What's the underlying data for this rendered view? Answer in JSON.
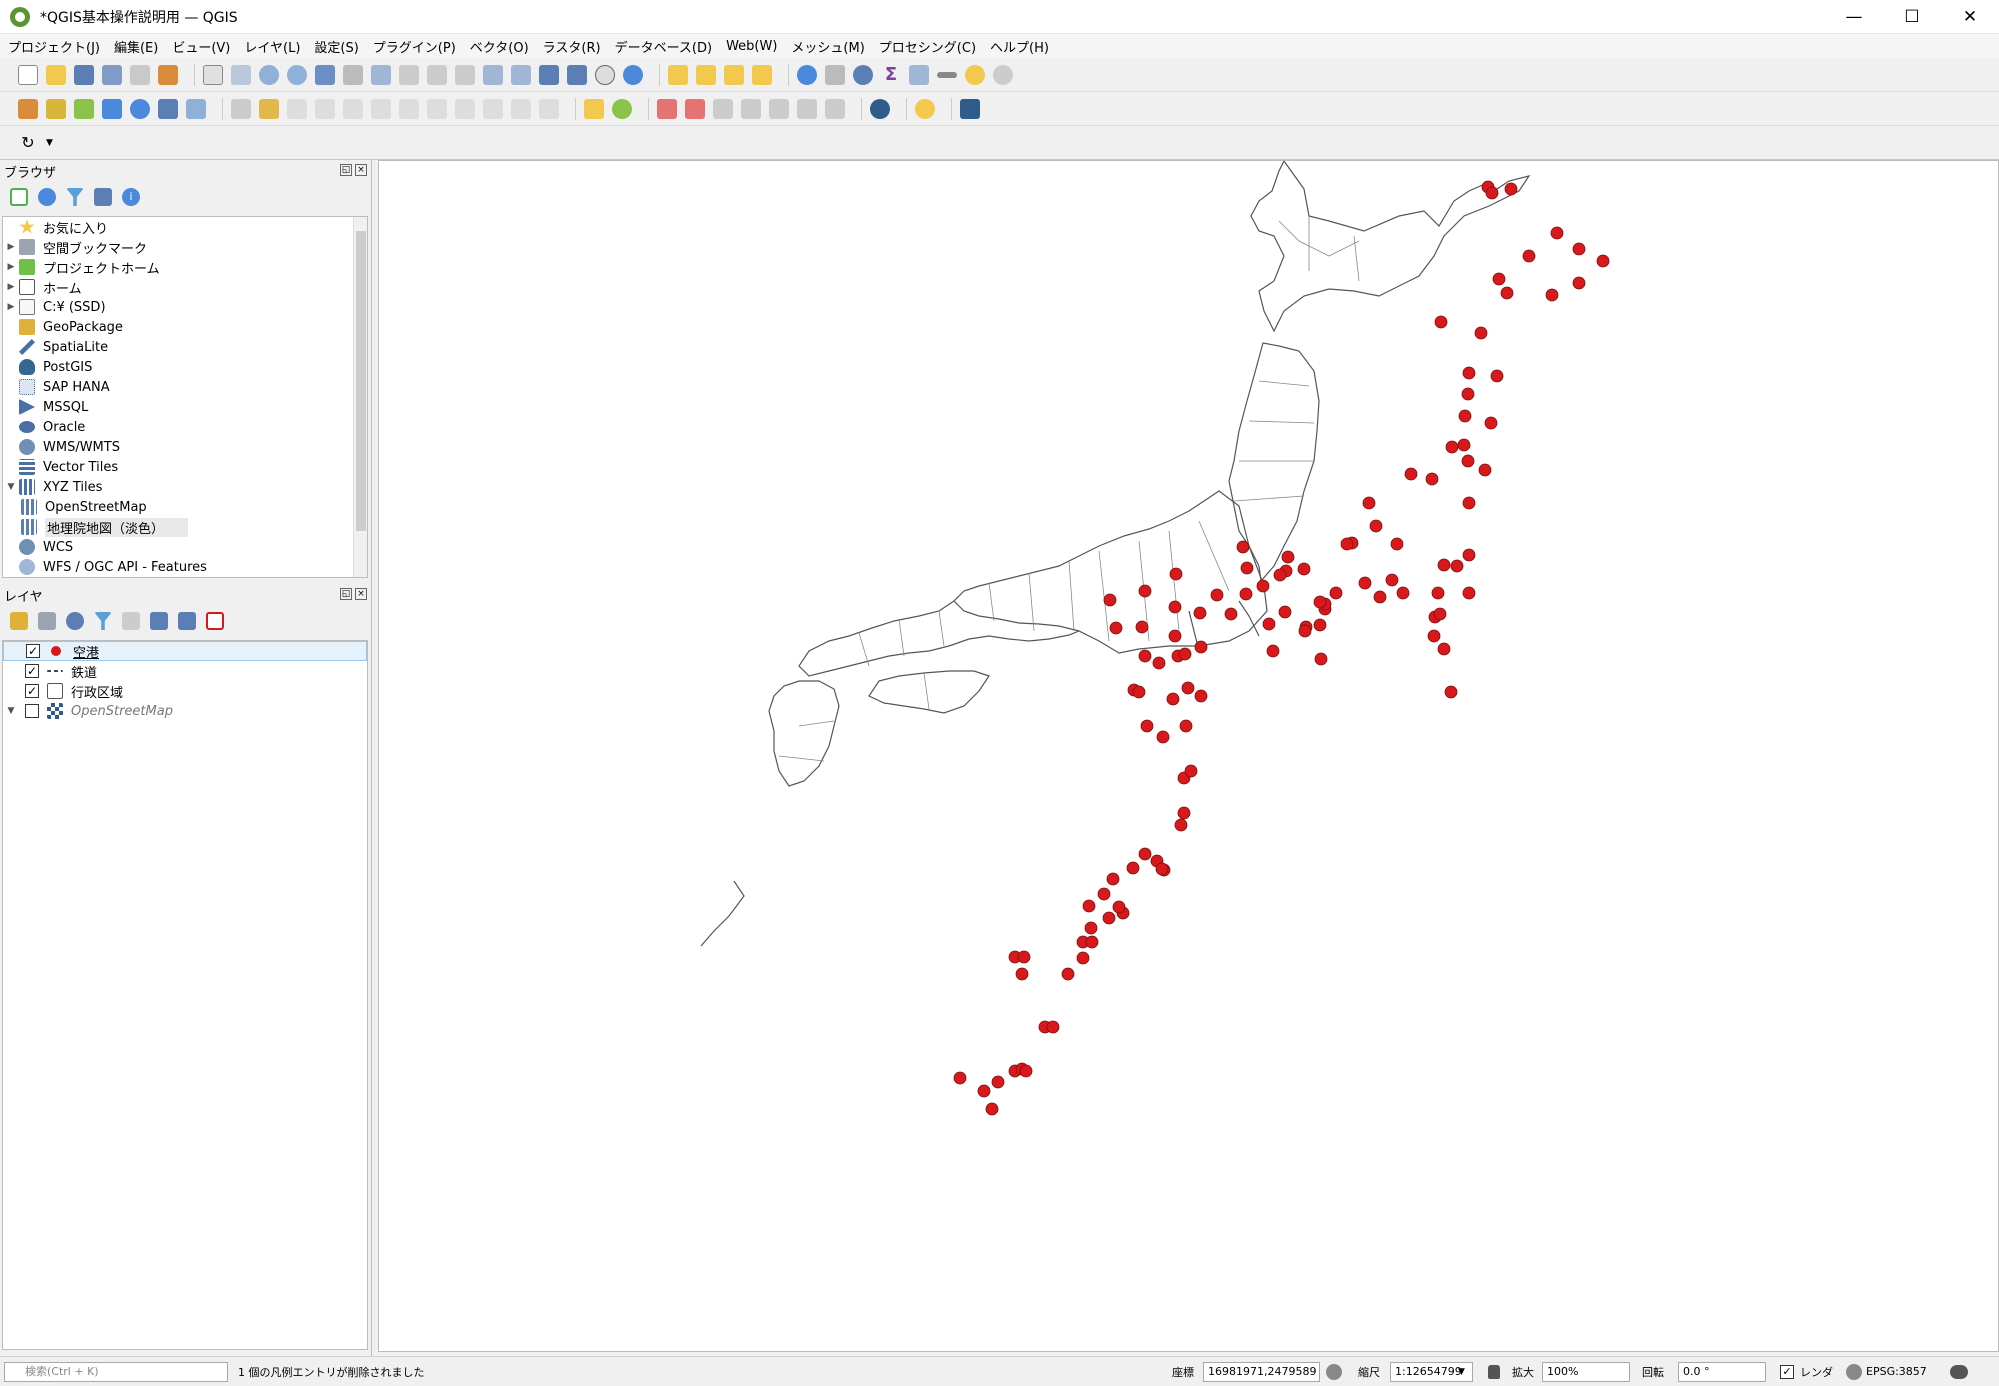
{
  "window": {
    "title": "*QGIS基本操作説明用 — QGIS",
    "controls": [
      "—",
      "☐",
      "✕"
    ]
  },
  "menu": [
    "プロジェクト(J)",
    "編集(E)",
    "ビュー(V)",
    "レイヤ(L)",
    "設定(S)",
    "プラグイン(P)",
    "ベクタ(O)",
    "ラスタ(R)",
    "データベース(D)",
    "Web(W)",
    "メッシュ(M)",
    "プロセシング(C)",
    "ヘルプ(H)"
  ],
  "browser": {
    "title": "ブラウザ",
    "items": [
      {
        "label": "お気に入り",
        "icon": "star-icon"
      },
      {
        "label": "空間ブックマーク",
        "icon": "bookmark-icon"
      },
      {
        "label": "プロジェクトホーム",
        "icon": "project-home-icon"
      },
      {
        "label": "ホーム",
        "icon": "home-icon"
      },
      {
        "label": "C:¥ (SSD)",
        "icon": "drive-icon"
      },
      {
        "label": "GeoPackage",
        "icon": "geopackage-icon"
      },
      {
        "label": "SpatiaLite",
        "icon": "spatialite-icon"
      },
      {
        "label": "PostGIS",
        "icon": "postgis-icon"
      },
      {
        "label": "SAP HANA",
        "icon": "saphana-icon"
      },
      {
        "label": "MSSQL",
        "icon": "mssql-icon"
      },
      {
        "label": "Oracle",
        "icon": "oracle-icon"
      },
      {
        "label": "WMS/WMTS",
        "icon": "wms-icon"
      },
      {
        "label": "Vector Tiles",
        "icon": "vector-tiles-icon"
      },
      {
        "label": "XYZ Tiles",
        "icon": "xyz-tiles-icon"
      },
      {
        "label": "OpenStreetMap",
        "icon": "xyz-tile-layer-icon"
      },
      {
        "label": "地理院地図（淡色）",
        "icon": "xyz-tile-layer-icon"
      },
      {
        "label": "WCS",
        "icon": "wcs-icon"
      },
      {
        "label": "WFS / OGC API - Features",
        "icon": "wfs-icon"
      }
    ]
  },
  "layers": {
    "title": "レイヤ",
    "items": [
      {
        "label": "空港",
        "checked": true
      },
      {
        "label": "鉄道",
        "checked": true
      },
      {
        "label": "行政区域",
        "checked": true
      },
      {
        "label": "OpenStreetMap",
        "checked": false
      }
    ]
  },
  "status": {
    "search_placeholder": "検索(Ctrl + K)",
    "message": "1 個の凡例エントリが削除されました",
    "coord_label": "座標",
    "coord_value": "16981971,2479589",
    "scale_label": "縮尺",
    "scale_value": "1:12654799",
    "magnifier_label": "拡大",
    "magnifier_value": "100%",
    "rotation_label": "回転",
    "rotation_value": "0.0 °",
    "render_label": "レンダ",
    "crs": "EPSG:3857"
  },
  "colors": {
    "airport": "#d7191c",
    "boundary": "#555555",
    "accent": "#589632"
  }
}
